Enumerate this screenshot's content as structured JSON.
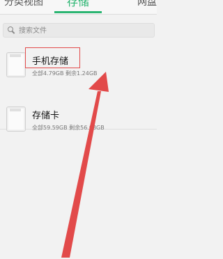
{
  "tabs": {
    "left": "分类视图",
    "center": "存储",
    "right": "网盘"
  },
  "search": {
    "placeholder": "搜索文件"
  },
  "storage": [
    {
      "title": "手机存储",
      "detail": "全部4.79GB 剩余1.24GB"
    },
    {
      "title": "存储卡",
      "detail": "全部59.59GB 剩余56.08GB"
    }
  ],
  "colors": {
    "accent": "#2bb572",
    "annotation": "#e24a4a"
  }
}
